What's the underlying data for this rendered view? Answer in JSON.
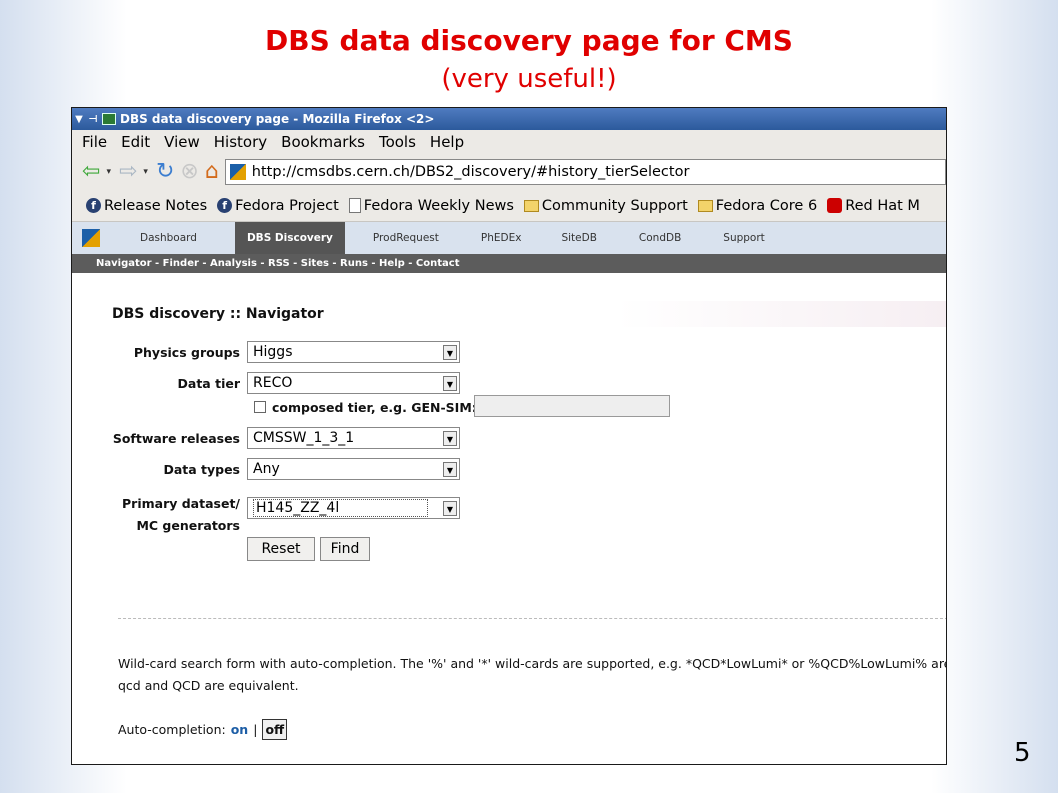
{
  "slide": {
    "title": "DBS data discovery page for CMS",
    "subtitle": "(very useful!)",
    "page_number": "5"
  },
  "browser": {
    "window_title": "DBS data discovery page - Mozilla Firefox <2>",
    "menu": [
      "File",
      "Edit",
      "View",
      "History",
      "Bookmarks",
      "Tools",
      "Help"
    ],
    "url": "http://cmsdbs.cern.ch/DBS2_discovery/#history_tierSelector",
    "bookmarks": [
      {
        "label": "Release Notes",
        "icon": "fedora-icon"
      },
      {
        "label": "Fedora Project",
        "icon": "fedora-icon"
      },
      {
        "label": "Fedora Weekly News",
        "icon": "page-icon"
      },
      {
        "label": "Community Support",
        "icon": "folder-icon"
      },
      {
        "label": "Fedora Core 6",
        "icon": "folder-icon"
      },
      {
        "label": "Red Hat M",
        "icon": "redhat-icon"
      }
    ]
  },
  "cms_nav": {
    "tabs": [
      "Dashboard",
      "DBS Discovery",
      "ProdRequest",
      "PhEDEx",
      "SiteDB",
      "CondDB",
      "Support"
    ],
    "active_tab": "DBS Discovery",
    "subnav": "Navigator - Finder - Analysis - RSS - Sites - Runs - Help - Contact"
  },
  "form": {
    "heading": "DBS discovery :: Navigator",
    "physics_groups": {
      "label": "Physics groups",
      "value": "Higgs"
    },
    "data_tier": {
      "label": "Data tier",
      "value": "RECO"
    },
    "composed_tier_label": "composed tier, e.g. GEN-SIM:",
    "software_releases": {
      "label": "Software releases",
      "value": "CMSSW_1_3_1"
    },
    "data_types": {
      "label": "Data types",
      "value": "Any"
    },
    "primary_dataset": {
      "label_line1": "Primary dataset/",
      "label_line2": "MC generators",
      "value": "H145_ZZ_4l"
    },
    "reset_label": "Reset",
    "find_label": "Find"
  },
  "help": {
    "line1": "Wild-card search form with auto-completion. The '%' and '*' wild-cards are supported, e.g. *QCD*LowLumi* or %QCD%LowLumi% are",
    "line2": "qcd and QCD are equivalent.",
    "auto_label": "Auto-completion:",
    "auto_on": "on",
    "auto_sep": "|",
    "auto_off": "off"
  }
}
